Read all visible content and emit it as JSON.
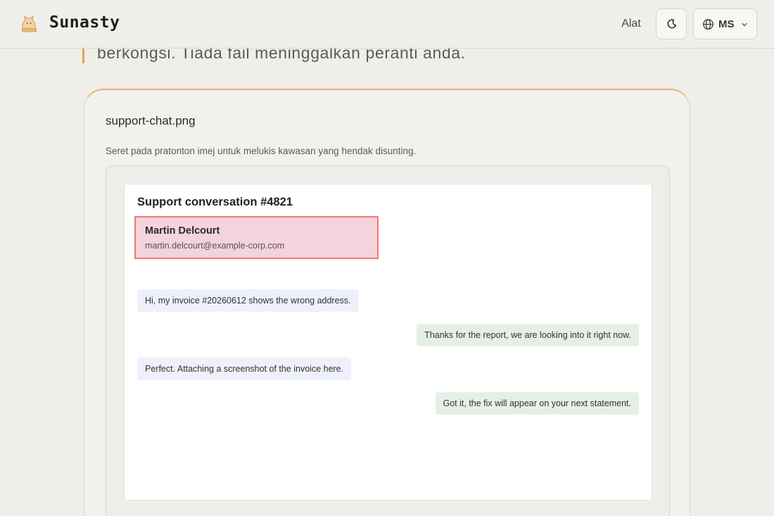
{
  "header": {
    "brand": "Sunasty",
    "nav_tools": "Alat",
    "theme_toggle_icon": "moon-icon",
    "language": {
      "icon": "globe-icon",
      "label": "MS",
      "chevron": "chevron-down-icon"
    }
  },
  "intro": {
    "text": "berkongsi. Tiada fail meninggalkan peranti anda.",
    "accent_color": "#e8a24a"
  },
  "editor": {
    "filename": "support-chat.png",
    "hint": "Seret pada pratonton imej untuk melukis kawasan yang hendak disunting."
  },
  "preview": {
    "title": "Support conversation #4821",
    "contact": {
      "name": "Martin Delcourt",
      "email": "martin.delcourt@example-corp.com",
      "selection_color": "#f17a6d"
    },
    "messages": [
      {
        "side": "incoming",
        "text": "Hi, my invoice #20260612 shows the wrong address."
      },
      {
        "side": "outgoing",
        "text": "Thanks for the report, we are looking into it right now."
      },
      {
        "side": "incoming",
        "text": "Perfect. Attaching a screenshot of the invoice here."
      },
      {
        "side": "outgoing",
        "text": "Got it, the fix will appear on your next statement."
      }
    ]
  }
}
